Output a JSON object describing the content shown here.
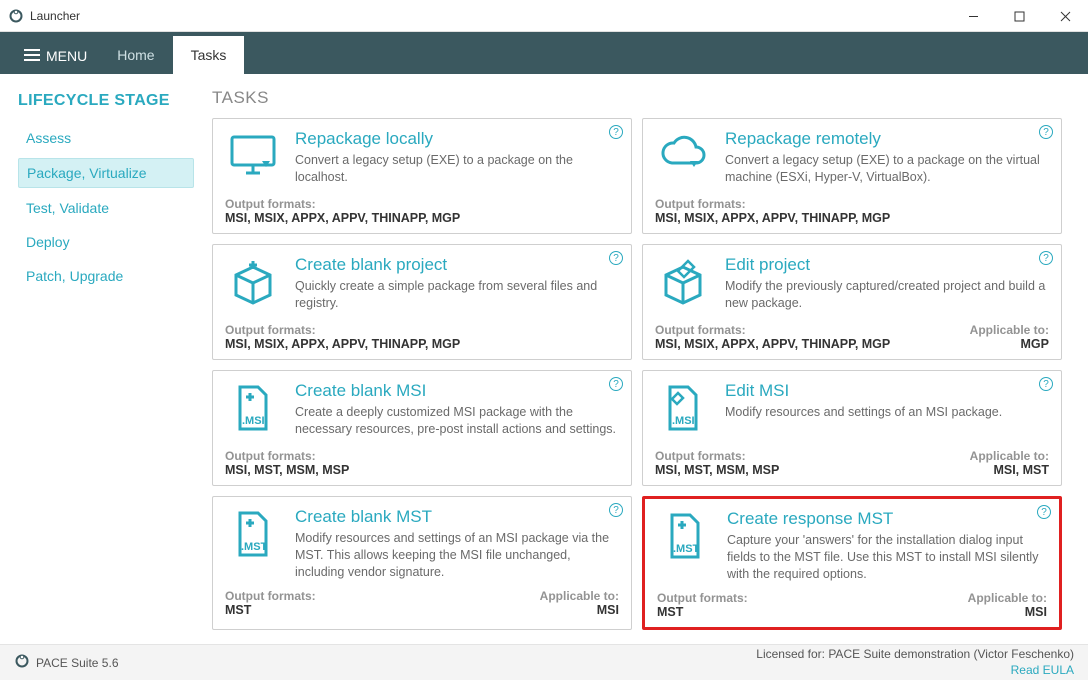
{
  "window": {
    "title": "Launcher"
  },
  "topbar": {
    "menu": "MENU",
    "home": "Home",
    "tasks": "Tasks"
  },
  "sidebar": {
    "heading": "LIFECYCLE STAGE",
    "items": [
      {
        "label": "Assess"
      },
      {
        "label": "Package, Virtualize",
        "active": true
      },
      {
        "label": "Test, Validate"
      },
      {
        "label": "Deploy"
      },
      {
        "label": "Patch, Upgrade"
      }
    ]
  },
  "content": {
    "heading": "TASKS"
  },
  "labels": {
    "output_formats": "Output formats:",
    "applicable_to": "Applicable to:"
  },
  "cards": {
    "repackage_local": {
      "title": "Repackage locally",
      "desc": "Convert a legacy setup (EXE) to a package on the localhost.",
      "output": "MSI, MSIX, APPX, APPV, THINAPP, MGP"
    },
    "repackage_remote": {
      "title": "Repackage remotely",
      "desc": "Convert a legacy setup (EXE) to a package on the virtual machine (ESXi, Hyper-V, VirtualBox).",
      "output": "MSI, MSIX, APPX, APPV, THINAPP, MGP"
    },
    "create_blank_project": {
      "title": "Create blank project",
      "desc": "Quickly create a simple package from several files and registry.",
      "output": "MSI, MSIX, APPX, APPV, THINAPP, MGP"
    },
    "edit_project": {
      "title": "Edit project",
      "desc": "Modify the previously captured/created project and build a new package.",
      "output": "MSI, MSIX, APPX, APPV, THINAPP, MGP",
      "applicable": "MGP"
    },
    "create_blank_msi": {
      "title": "Create blank MSI",
      "desc": "Create a deeply customized MSI package with the necessary resources, pre-post install actions and settings.",
      "output": "MSI, MST, MSM, MSP"
    },
    "edit_msi": {
      "title": "Edit MSI",
      "desc": "Modify resources and settings of an MSI package.",
      "output": "MSI, MST, MSM, MSP",
      "applicable": "MSI, MST"
    },
    "create_blank_mst": {
      "title": "Create blank MST",
      "desc": "Modify resources and settings of an MSI package via the MST. This allows keeping the MSI file unchanged, including vendor signature.",
      "output": "MST",
      "applicable": "MSI"
    },
    "create_response_mst": {
      "title": "Create response MST",
      "desc": "Capture your 'answers' for the installation dialog input fields to the MST file. Use this MST to install MSI silently with the required options.",
      "output": "MST",
      "applicable": "MSI"
    }
  },
  "status": {
    "product": "PACE Suite 5.6",
    "licensed": "Licensed for: PACE Suite demonstration (Victor Feschenko)",
    "eula": "Read EULA"
  }
}
